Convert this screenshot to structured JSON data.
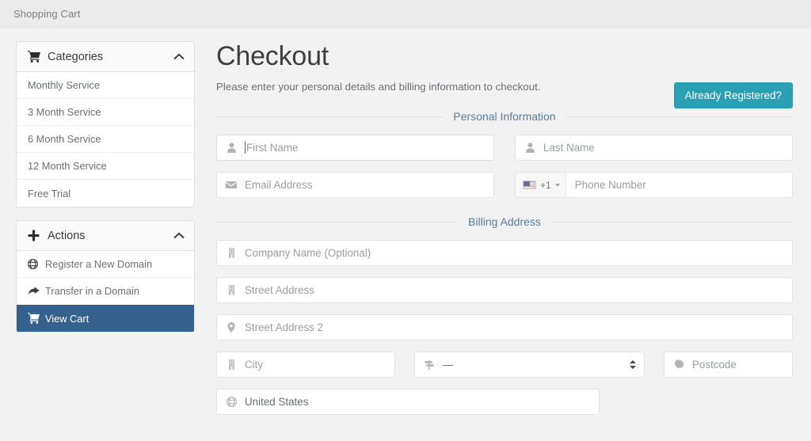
{
  "topbar": {
    "title": "Shopping Cart"
  },
  "sidebar": {
    "categories_panel": {
      "icon": "cart-icon",
      "title": "Categories",
      "collapse_icon": "chevron-up-icon",
      "items": [
        {
          "label": "Monthly Service"
        },
        {
          "label": "3 Month Service"
        },
        {
          "label": "6 Month Service"
        },
        {
          "label": "12 Month Service"
        },
        {
          "label": "Free Trial"
        }
      ]
    },
    "actions_panel": {
      "icon": "plus-icon",
      "title": "Actions",
      "collapse_icon": "chevron-up-icon",
      "items": [
        {
          "label": "Register a New Domain",
          "icon": "globe-icon",
          "active": false
        },
        {
          "label": "Transfer in a Domain",
          "icon": "share-arrow-icon",
          "active": false
        },
        {
          "label": "View Cart",
          "icon": "cart-icon",
          "active": true
        }
      ]
    }
  },
  "main": {
    "title": "Checkout",
    "subtitle": "Please enter your personal details and billing information to checkout.",
    "already_registered_label": "Already Registered?",
    "sections": {
      "personal": "Personal Information",
      "billing": "Billing Address"
    },
    "fields": {
      "first_name": {
        "placeholder": "First Name",
        "value": "",
        "icon": "user-icon"
      },
      "last_name": {
        "placeholder": "Last Name",
        "value": "",
        "icon": "user-icon"
      },
      "email": {
        "placeholder": "Email Address",
        "value": "",
        "icon": "envelope-icon"
      },
      "phone": {
        "placeholder": "Phone Number",
        "value": "",
        "dial_code": "+1",
        "flag": "us-flag-icon"
      },
      "company": {
        "placeholder": "Company Name (Optional)",
        "value": "",
        "icon": "building-icon"
      },
      "street1": {
        "placeholder": "Street Address",
        "value": "",
        "icon": "building-icon"
      },
      "street2": {
        "placeholder": "Street Address 2",
        "value": "",
        "icon": "map-marker-icon"
      },
      "city": {
        "placeholder": "City",
        "value": "",
        "icon": "building-icon"
      },
      "state": {
        "selected": "—",
        "icon": "map-signs-icon"
      },
      "postcode": {
        "placeholder": "Postcode",
        "value": "",
        "icon": "circle-icon"
      },
      "country": {
        "selected": "United States",
        "icon": "globe-icon"
      }
    }
  },
  "colors": {
    "accent_teal": "#2ba0b4",
    "active_blue": "#35618f",
    "section_heading": "#5c7b96"
  }
}
